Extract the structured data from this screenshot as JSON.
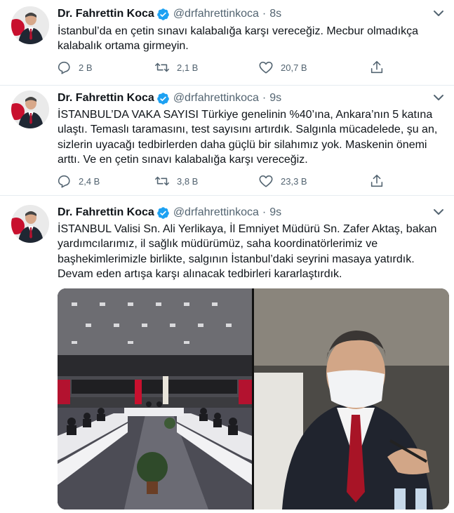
{
  "tweets": [
    {
      "name": "Dr. Fahrettin Koca",
      "handle": "@drfahrettinkoca",
      "dot": "·",
      "time": "8s",
      "text": "İstanbul’da en çetin sınavı kalabalığa karşı vereceğiz. Mecbur olmadıkça kalabalık ortama girmeyin.",
      "replies": "2 B",
      "retweets": "2,1 B",
      "likes": "20,7 B"
    },
    {
      "name": "Dr. Fahrettin Koca",
      "handle": "@drfahrettinkoca",
      "dot": "·",
      "time": "9s",
      "text": "İSTANBUL’DA VAKA SAYISI Türkiye genelinin %40’ına, Ankara’nın 5 katına ulaştı. Temaslı taramasını, test sayısını artırdık. Salgınla mücadelede, şu an, sizlerin uyacağı tedbirlerden daha güçlü bir silahımız yok. Maskenin önemi arttı. Ve en çetin sınavı kalabalığa karşı vereceğiz.",
      "replies": "2,4 B",
      "retweets": "3,8 B",
      "likes": "23,3 B"
    },
    {
      "name": "Dr. Fahrettin Koca",
      "handle": "@drfahrettinkoca",
      "dot": "·",
      "time": "9s",
      "text": "İSTANBUL Valisi Sn. Ali Yerlikaya, İl Emniyet Müdürü Sn. Zafer Aktaş, bakan yardımcılarımız, il sağlık müdürümüz, saha koordinatörlerimiz ve başhekimlerimizle birlikte, salgının İstanbul’daki seyrini masaya yatırdık. Devam eden artışa karşı alınacak tedbirleri kararlaştırdık."
    }
  ],
  "icons": {
    "verified": "verified-badge-icon",
    "more": "chevron-down-icon",
    "reply": "reply-icon",
    "retweet": "retweet-icon",
    "like": "heart-icon",
    "share": "share-icon"
  },
  "colors": {
    "verified": "#1da1f2",
    "text": "#0f1419",
    "muted": "#536471",
    "divider": "#e6ecf0"
  }
}
